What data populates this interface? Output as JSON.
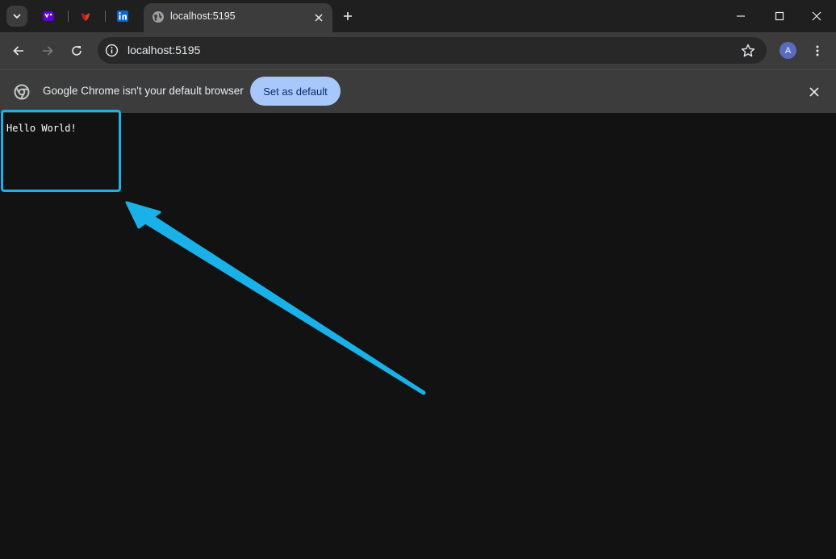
{
  "browser": {
    "active_tab": {
      "title": "localhost:5195",
      "favicon": "globe-icon"
    },
    "pinned_tabs": [
      {
        "favicon": "yahoo-mail-icon"
      },
      {
        "favicon": "red-app-icon"
      },
      {
        "favicon": "linkedin-icon",
        "text": "in"
      }
    ],
    "url": "localhost:5195",
    "avatar_letter": "A"
  },
  "infobar": {
    "message": "Google Chrome isn't your default browser",
    "button_label": "Set as default"
  },
  "page": {
    "text": "Hello World!"
  },
  "colors": {
    "annotation": "#1ab0e8",
    "accent_button": "#a8c7fa",
    "page_background": "#121212"
  }
}
